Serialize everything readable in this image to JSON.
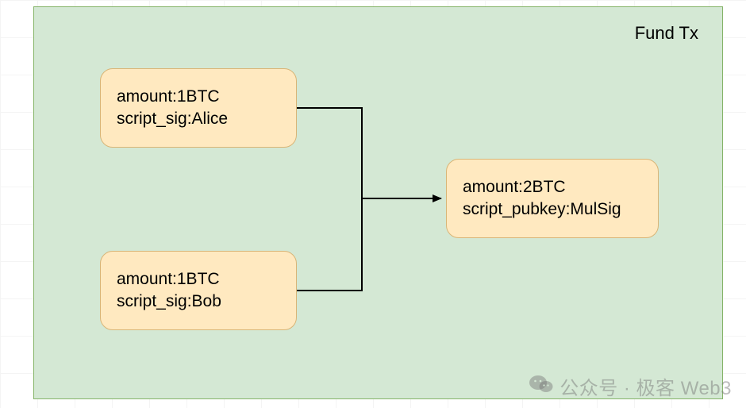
{
  "diagram": {
    "title": "Fund Tx",
    "inputs": [
      {
        "amount_line": "amount:1BTC",
        "script_line": "script_sig:Alice"
      },
      {
        "amount_line": "amount:1BTC",
        "script_line": "script_sig:Bob"
      }
    ],
    "output": {
      "amount_line": "amount:2BTC",
      "script_line": "script_pubkey:MulSig"
    }
  },
  "watermark": {
    "text": "公众号 · 极客 Web3"
  }
}
